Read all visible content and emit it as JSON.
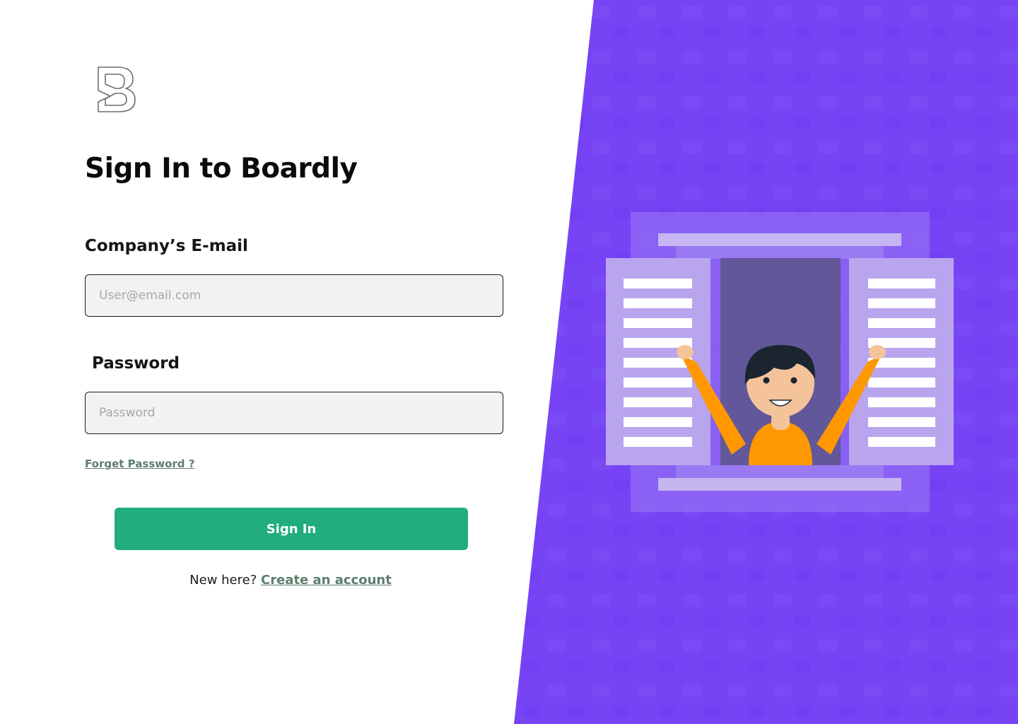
{
  "brand": {
    "logo_icon": "boardly-b-logo-icon"
  },
  "form": {
    "title": "Sign In to Boardly",
    "email": {
      "label": "Company’s E-mail",
      "placeholder": "User@email.com",
      "value": ""
    },
    "password": {
      "label": "Password",
      "placeholder": "Password",
      "value": ""
    },
    "forgot_link": "Forget Password ?",
    "submit_label": "Sign In",
    "signup_prompt": "New here?",
    "signup_link": "Create an account"
  },
  "hero": {
    "illustration": "person-waving-from-window-illustration"
  },
  "colors": {
    "accent_purple": "#7643f5",
    "primary_green": "#21ad7d",
    "link_green": "#5d7d6d",
    "input_bg": "#f2f2f2",
    "shirt_orange": "#ff9800"
  }
}
